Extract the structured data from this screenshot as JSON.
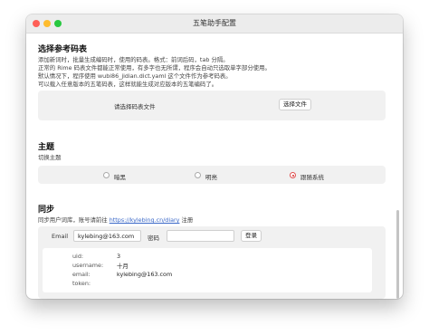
{
  "window": {
    "title": "五笔助手配置"
  },
  "dict": {
    "heading": "选择参考码表",
    "desc": [
      "添加新词时，批量生成编码时，使用的码表。格式：前词后码，tab 分隔。",
      "正常的 Rime 码表文件都能正常使用，有多字也无所谓，程序会自动只选取单字部分使用。",
      "默认情况下，程序使用 wubi86_jidian.dict.yaml 这个文件作为参考码表。",
      "可以载入任意版本的五笔码表，这样就能生成对应版本的五笔编码了。"
    ],
    "prompt": "请选择码表文件",
    "choose_button": "选择文件"
  },
  "theme": {
    "heading": "主题",
    "subtitle": "切换主题",
    "options": [
      "暗黑",
      "明亮",
      "跟随系统"
    ],
    "selected": "跟随系统"
  },
  "sync": {
    "heading": "同步",
    "desc_prefix": "同步用户词库，账号请前往",
    "link": "https://kylebing.cn/diary",
    "desc_suffix": "注册",
    "email_label": "Email",
    "email_value": "kylebing@163.com",
    "password_label": "密码",
    "password_value": "",
    "login_button": "登录",
    "info": {
      "uid_label": "uid:",
      "uid": "3",
      "username_label": "username:",
      "username": "十月",
      "email_label": "email:",
      "email": "kylebing@163.com",
      "token_label": "token:",
      "token": ""
    }
  },
  "colors": {
    "accent": "#d03030",
    "link": "#3a68c8"
  }
}
